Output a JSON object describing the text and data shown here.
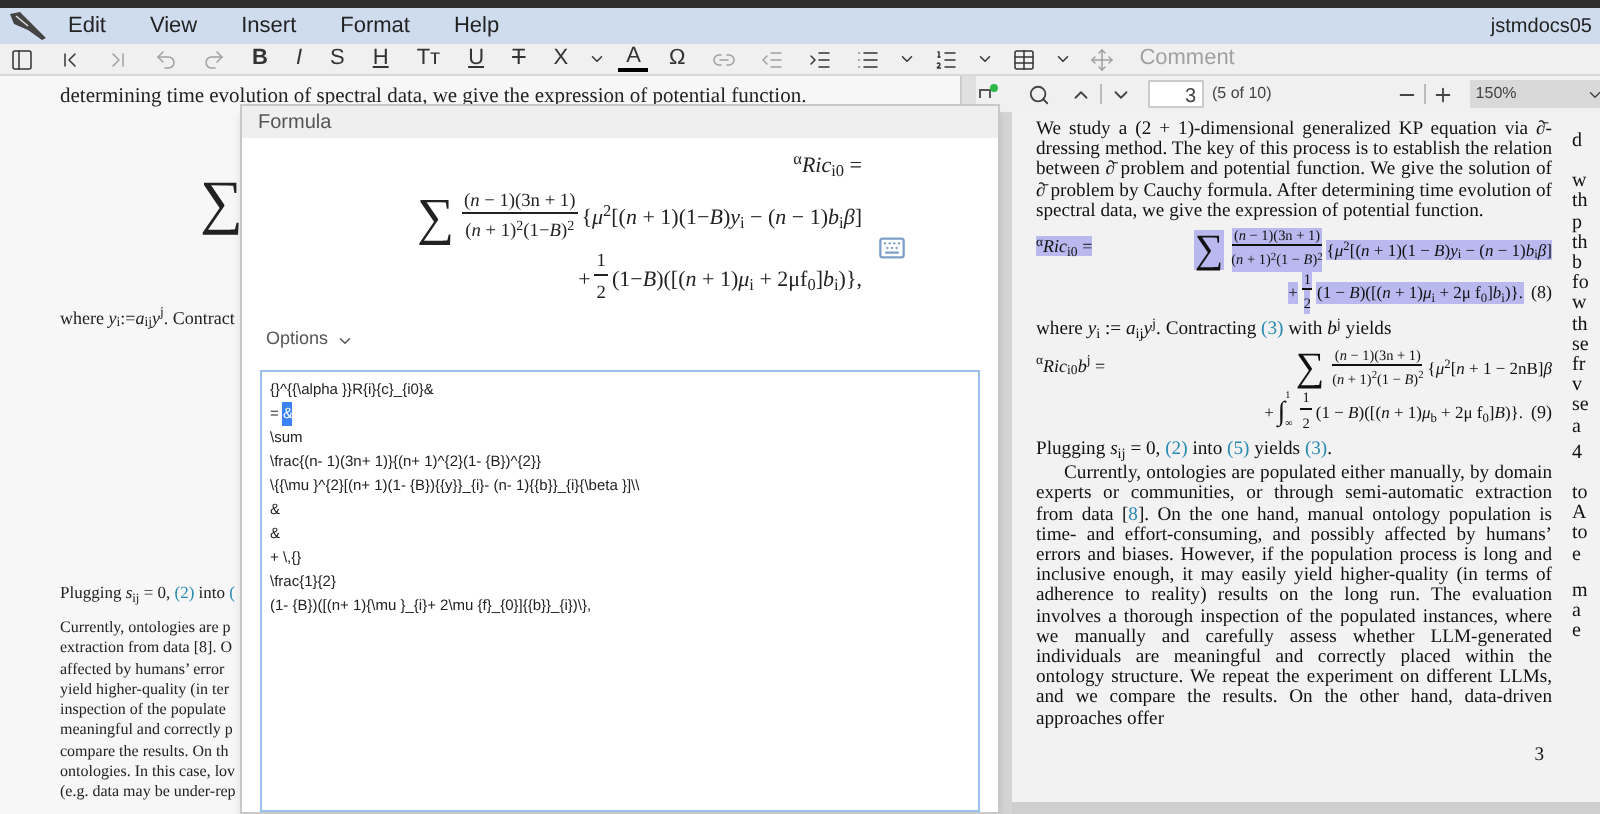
{
  "menu_bar": {
    "items": [
      "Edit",
      "View",
      "Insert",
      "Format",
      "Help"
    ],
    "document_title": "jstmdocs05"
  },
  "toolbar": [
    {
      "kind": "icon",
      "disabled": false
    },
    {
      "kind": "icon",
      "disabled": false
    },
    {
      "kind": "icon",
      "disabled": true
    },
    {
      "kind": "icon",
      "disabled": true
    },
    {
      "kind": "icon",
      "disabled": true
    },
    {
      "kind": "bold",
      "label": "B",
      "disabled": false
    },
    {
      "kind": "italic",
      "label": "I",
      "disabled": false
    },
    {
      "kind": "plain",
      "label": "S",
      "disabled": false
    },
    {
      "kind": "underline",
      "label": "H",
      "disabled": false
    },
    {
      "kind": "plain",
      "label": "Tт",
      "disabled": false
    },
    {
      "kind": "underline",
      "label": "U",
      "disabled": false
    },
    {
      "kind": "strike",
      "label": "T",
      "disabled": false
    },
    {
      "kind": "plain",
      "label": "X",
      "disabled": false
    },
    {
      "kind": "caret",
      "disabled": false
    },
    {
      "kind": "color",
      "label": "A",
      "disabled": false
    },
    {
      "kind": "plain",
      "label": "Ω",
      "disabled": false
    },
    {
      "kind": "icon",
      "disabled": true
    },
    {
      "kind": "icon",
      "disabled": true
    },
    {
      "kind": "icon",
      "disabled": false
    },
    {
      "kind": "icon",
      "disabled": false
    },
    {
      "kind": "caret",
      "disabled": false
    },
    {
      "kind": "icon",
      "disabled": false
    },
    {
      "kind": "caret",
      "disabled": false
    },
    {
      "kind": "icon",
      "disabled": false
    },
    {
      "kind": "caret",
      "disabled": false
    },
    {
      "kind": "icon",
      "disabled": true
    },
    {
      "kind": "plain",
      "label": "Comment",
      "disabled": true
    }
  ],
  "editor_document": {
    "top_line": "determining time evolution of spectral data, we give the expression of potential function.",
    "sum_sign": "∑",
    "where_line": "where *y*$_{i}$:=*a*$_{ij}$*y*$^{j}$. Contract",
    "plugging_line": [
      {
        "kind": "text",
        "s": "Plugging *s*$_{ij}$ = 0, "
      },
      {
        "kind": "link",
        "s": "(2)"
      },
      {
        "kind": "text",
        "s": " into "
      },
      {
        "kind": "link",
        "s": "("
      }
    ],
    "paragraph_lines": [
      "Currently, ontologies are p",
      "extraction from data [8]. O",
      "affected by humans’ error",
      "yield higher-quality (in ter",
      "inspection of the populate",
      "meaningful and correctly p",
      "compare the results. On th",
      "ontologies. In this case, lov",
      "(e.g. data may be under-rep"
    ]
  },
  "formula_dialog": {
    "title": "Formula",
    "preview": [
      [
        {
          "kind": "text",
          "s": "$^{α}$*Ric*$_{i0}$ ="
        }
      ],
      [
        {
          "kind": "sum",
          "s": "∑"
        },
        {
          "kind": "frac",
          "num": "(*n* − 1)(3n + 1)",
          "den": "(*n* + 1)$^{2}$(1−*B*)$^{2}$"
        },
        {
          "kind": "text",
          "s": "{*μ*$^{2}$[(*n* + 1)(1−*B*)*y*$_{i}$ − (*n* − 1)*b*$_{i}$*β*]"
        }
      ],
      [
        {
          "kind": "text",
          "s": "+"
        },
        {
          "kind": "frac",
          "num": "1",
          "den": "2"
        },
        {
          "kind": "text",
          "s": "(1−*B*)([(*n* + 1)*μ*$_{i}$ + 2μf$_{0}$]*b*$_{i}$)},"
        }
      ]
    ],
    "options_label": "Options",
    "source_lines": [
      {
        "text": "{}^{{\\alpha }}R{i}{c}_{i0}&"
      },
      {
        "text": "= ",
        "selected_text": "&"
      },
      {
        "text": "\\sum"
      },
      {
        "text": "\\frac{(n- 1)(3n+ 1)}{(n+ 1)^{2}(1- {B})^{2}}"
      },
      {
        "text": "\\{{\\mu }^{2}[(n+ 1)(1- {B}){{y}}_{i}- (n- 1){{b}}_{i}{\\beta }]\\\\"
      },
      {
        "text": "&"
      },
      {
        "text": "&"
      },
      {
        "text": "+ \\,{}"
      },
      {
        "text": "\\frac{1}{2}"
      },
      {
        "text": "(1- {B})([(n+ 1){\\mu }_{i}+ 2\\mu {f}_{0}]{{b}}_{i})\\},"
      }
    ]
  },
  "pdf_toolbar": {
    "page": "3",
    "page_count": "(5 of 10)",
    "zoom": "150%"
  },
  "pdf_page": {
    "blocks": [
      {
        "kind": "paragraph",
        "parts": [
          {
            "kind": "text",
            "s": "We study a (2 + 1)-dimensional generalized KP equation via ∂̄-dressing method. The key of this process is to establish the relation between ∂̄ problem and potential function. We give the solution of ∂̄ problem by Cauchy formula. After determining time evolution of spectral data, we give the expression of potential function."
          }
        ]
      },
      {
        "kind": "equation",
        "selected": true,
        "label": "$^{α}$*Ric*$_{i0}$ =",
        "number": "(8)",
        "lines": [
          [
            {
              "kind": "sum",
              "s": "∑"
            },
            {
              "kind": "frac",
              "num": "(*n* − 1)(3n + 1)",
              "den": "(*n* + 1)$^{2}$(1 − *B*)$^{2}$"
            },
            {
              "kind": "text",
              "s": "{*μ*$^{2}$[(*n* + 1)(1 − *B*)*y*$_{i}$ − (*n* − 1)*b*$_{i}$*β*]"
            }
          ],
          [
            {
              "kind": "text",
              "s": "+"
            },
            {
              "kind": "frac",
              "num": "1",
              "den": "2"
            },
            {
              "kind": "text",
              "s": "(1 − *B*)([(*n* + 1)*μ*$_{i}$ + 2μ f$_{0}$]*b*$_{i}$)}."
            }
          ]
        ]
      },
      {
        "kind": "paragraph",
        "parts": [
          {
            "kind": "text",
            "s": "where *y*$_{i}$ := *a*$_{ij}$*y*$^{j}$. Contracting "
          },
          {
            "kind": "link",
            "s": "(3)"
          },
          {
            "kind": "text",
            "s": " with *b*$^{j}$ yields"
          }
        ]
      },
      {
        "kind": "equation",
        "selected": false,
        "label": "$^{α}$*Ric*$_{i0}$*b*$^{j}$ =",
        "number": "(9)",
        "lines": [
          [
            {
              "kind": "sum",
              "s": "∑"
            },
            {
              "kind": "frac",
              "num": "(*n* − 1)(3n + 1)",
              "den": "(*n* + 1)$^{2}$(1 − *B*)$^{2}$"
            },
            {
              "kind": "text",
              "s": "{*μ*$^{2}$[*n* + 1 − 2nB]*β*"
            }
          ],
          [
            {
              "kind": "text",
              "s": "+"
            },
            {
              "kind": "integral",
              "s": "∫",
              "upper": "1",
              "lower": "∞"
            },
            {
              "kind": "frac",
              "num": "1",
              "den": "2"
            },
            {
              "kind": "text",
              "s": "(1 − *B*)([(*n* + 1)*μ*$_{b}$ + 2μ f$_{0}$]*B*)}."
            }
          ]
        ]
      },
      {
        "kind": "paragraph",
        "parts": [
          {
            "kind": "text",
            "s": "Plugging *s*$_{ij}$ = 0, "
          },
          {
            "kind": "link",
            "s": "(2)"
          },
          {
            "kind": "text",
            "s": " into "
          },
          {
            "kind": "link",
            "s": "(5)"
          },
          {
            "kind": "text",
            "s": " yields "
          },
          {
            "kind": "link",
            "s": "(3)"
          },
          {
            "kind": "text",
            "s": "."
          }
        ]
      },
      {
        "kind": "indented_paragraph",
        "parts": [
          {
            "kind": "text",
            "s": "Currently, ontologies are populated either manually, by domain experts or communities, or through semi-automatic extraction from data ["
          },
          {
            "kind": "link",
            "s": "8"
          },
          {
            "kind": "text",
            "s": "]. On the one hand, manual ontology population is time- and effort-consuming, and possibly affected by humans’ errors and biases. However, if the population process is long and inclusive enough, it may easily yield higher-quality (in terms of adherence to reality) results on the long run. The evaluation involves a thorough inspection of the populated instances, where we manually and carefully assess whether LLM-generated individuals are meaningful and correctly placed within the ontology structure. We repeat the experiment on different LLMs, and we compare the results. On the other hand, data-driven approaches offer"
          }
        ]
      }
    ],
    "page_number": "3",
    "next_column_fragments": [
      [
        "d"
      ],
      [
        "w",
        "th",
        "p",
        "th",
        "b",
        "fo",
        "w",
        "th",
        "se",
        "fr",
        "v",
        "se",
        "a"
      ],
      [
        "4"
      ],
      [
        "to",
        "A",
        "to",
        "e"
      ],
      [
        "m",
        "a",
        "e"
      ]
    ]
  }
}
